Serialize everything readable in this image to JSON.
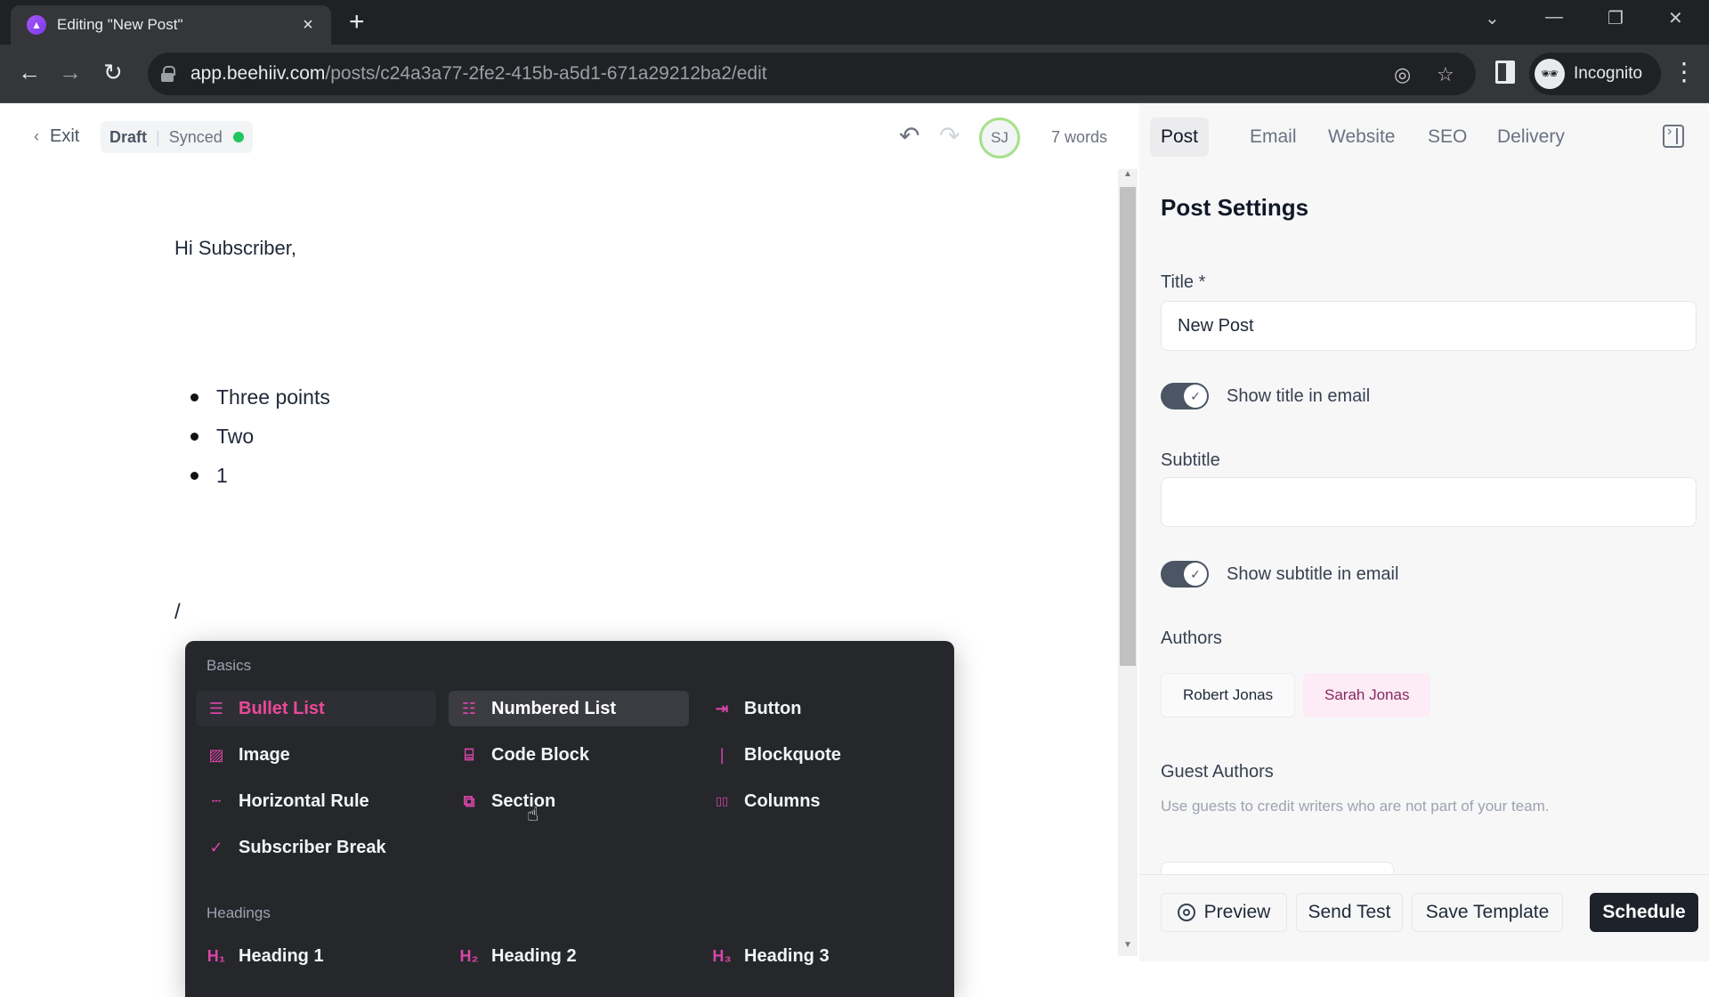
{
  "browser": {
    "tab_title": "Editing \"New Post\"",
    "tab_close": "×",
    "new_tab": "+",
    "url_host": "app.beehiiv.com",
    "url_path": "/posts/c24a3a77-2fe2-415b-a5d1-671a29212ba2/edit",
    "profile_label": "Incognito",
    "window_controls": {
      "tab_search": "⌄",
      "minimize": "—",
      "restore": "❐",
      "close": "✕"
    },
    "nav": {
      "back": "←",
      "forward": "→",
      "reload": "↻"
    },
    "omni_icons": {
      "eye_off": "◎",
      "bookmark": "☆"
    },
    "menu": "⋮"
  },
  "header": {
    "exit_label": "Exit",
    "status_draft": "Draft",
    "status_synced": "Synced",
    "sync_color": "#22c55e",
    "undo": "↶",
    "redo": "↷",
    "avatar_initials": "SJ",
    "word_count": "7 words"
  },
  "editor": {
    "greeting": "Hi Subscriber,",
    "bullets": [
      "Three points",
      "Two",
      "1"
    ],
    "slash_text": "/"
  },
  "slash_menu": {
    "sections": [
      {
        "title": "Basics",
        "items": [
          {
            "label": "Bullet List",
            "icon": "list-bullet-icon",
            "glyph": "☰",
            "state": "active"
          },
          {
            "label": "Numbered List",
            "icon": "list-numbered-icon",
            "glyph": "☷",
            "state": "hover"
          },
          {
            "label": "Button",
            "icon": "button-icon",
            "glyph": "⇥"
          },
          {
            "label": "Image",
            "icon": "image-icon",
            "glyph": "▨"
          },
          {
            "label": "Code Block",
            "icon": "code-block-icon",
            "glyph": "⌸"
          },
          {
            "label": "Blockquote",
            "icon": "blockquote-icon",
            "glyph": "❘"
          },
          {
            "label": "Horizontal Rule",
            "icon": "horizontal-rule-icon",
            "glyph": "┄"
          },
          {
            "label": "Section",
            "icon": "section-icon",
            "glyph": "⧉"
          },
          {
            "label": "Columns",
            "icon": "columns-icon",
            "glyph": "▯▯"
          },
          {
            "label": "Subscriber Break",
            "icon": "subscriber-break-icon",
            "glyph": "✓"
          }
        ]
      },
      {
        "title": "Headings",
        "items": [
          {
            "label": "Heading 1",
            "icon": "heading-1-icon",
            "glyph": "H₁"
          },
          {
            "label": "Heading 2",
            "icon": "heading-2-icon",
            "glyph": "H₂"
          },
          {
            "label": "Heading 3",
            "icon": "heading-3-icon",
            "glyph": "H₃"
          }
        ]
      }
    ],
    "accent_color": "#d946a8"
  },
  "panel": {
    "tabs": [
      {
        "label": "Post",
        "active": true
      },
      {
        "label": "Email"
      },
      {
        "label": "Website"
      },
      {
        "label": "SEO"
      },
      {
        "label": "Delivery"
      }
    ],
    "heading": "Post Settings",
    "title_label": "Title *",
    "title_value": "New Post",
    "show_title_label": "Show title in email",
    "show_title_on": true,
    "subtitle_label": "Subtitle",
    "subtitle_value": "",
    "show_subtitle_label": "Show subtitle in email",
    "show_subtitle_on": true,
    "authors_label": "Authors",
    "authors": [
      "Robert Jonas",
      "Sarah Jonas"
    ],
    "guest_authors_label": "Guest Authors",
    "guest_authors_desc": "Use guests to credit writers who are not part of your team.",
    "toggle_check": "✓",
    "footer": {
      "preview": "Preview",
      "send_test": "Send Test",
      "save_template": "Save Template",
      "schedule": "Schedule"
    }
  }
}
